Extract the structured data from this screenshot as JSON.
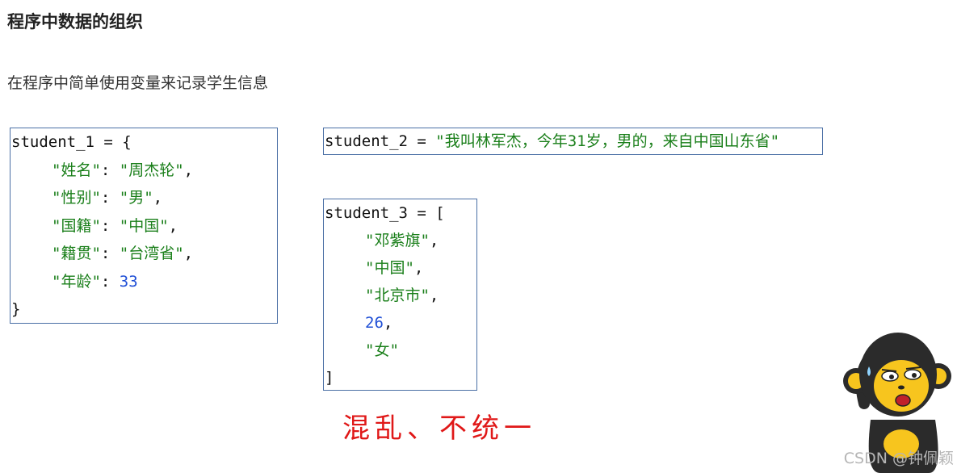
{
  "heading": "程序中数据的组织",
  "subtitle": "在程序中简单使用变量来记录学生信息",
  "student1": {
    "open": "student_1 = {",
    "entries": [
      {
        "key": "\"姓名\"",
        "sep": ": ",
        "value": "\"周杰轮\"",
        "tail": ",",
        "value_type": "str"
      },
      {
        "key": "\"性别\"",
        "sep": ": ",
        "value": "\"男\"",
        "tail": ",",
        "value_type": "str"
      },
      {
        "key": "\"国籍\"",
        "sep": ": ",
        "value": "\"中国\"",
        "tail": ",",
        "value_type": "str"
      },
      {
        "key": "\"籍贯\"",
        "sep": ": ",
        "value": "\"台湾省\"",
        "tail": ",",
        "value_type": "str"
      },
      {
        "key": "\"年龄\"",
        "sep": ": ",
        "value": "33",
        "tail": "",
        "value_type": "num"
      }
    ],
    "close": "}"
  },
  "student2": {
    "prefix": "student_2 = ",
    "value": "\"我叫林军杰，今年31岁，男的，来自中国山东省\""
  },
  "student3": {
    "open": "student_3 = [",
    "items": [
      {
        "text": "\"邓紫旗\"",
        "tail": ",",
        "type": "str"
      },
      {
        "text": "\"中国\"",
        "tail": ",",
        "type": "str"
      },
      {
        "text": "\"北京市\"",
        "tail": ",",
        "type": "str"
      },
      {
        "text": "26",
        "tail": ",",
        "type": "num"
      },
      {
        "text": "\"女\"",
        "tail": "",
        "type": "str"
      }
    ],
    "close": "]"
  },
  "annotation": "混乱、不统一",
  "watermark": "CSDN @钟佩颖",
  "colors": {
    "string": "#1a7f1a",
    "number": "#1f4fd6",
    "annotation": "#e01818",
    "box_border": "#4a6fa5"
  }
}
